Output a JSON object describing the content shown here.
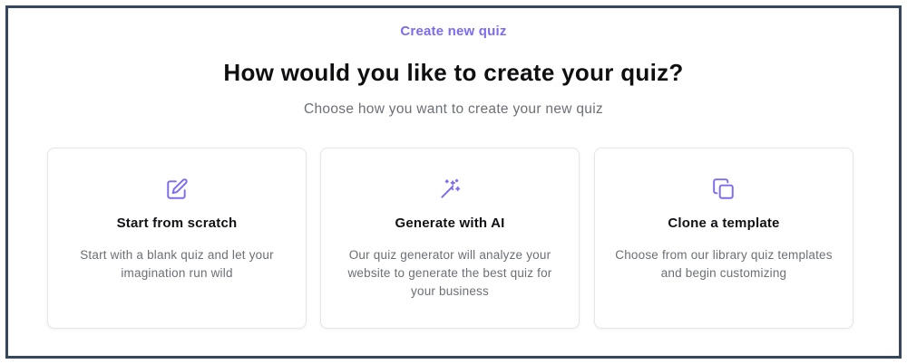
{
  "header": {
    "eyebrow": "Create new quiz",
    "title": "How would you like to create your quiz?",
    "subtitle": "Choose how you want to create your new quiz"
  },
  "options": [
    {
      "icon": "edit-icon",
      "title": "Start from scratch",
      "description": "Start with a blank quiz and let your imagination run wild"
    },
    {
      "icon": "magic-wand-icon",
      "title": "Generate with AI",
      "description": "Our quiz generator will analyze your website to generate the best quiz for your business"
    },
    {
      "icon": "copy-icon",
      "title": "Clone a template",
      "description": "Choose from our library quiz templates and begin customizing"
    }
  ],
  "colors": {
    "accent": "#7b6cf0",
    "frame_border": "#34475c",
    "card_border": "#e4e6ea",
    "text_primary": "#0f0f12",
    "text_secondary": "#6b6f76"
  }
}
